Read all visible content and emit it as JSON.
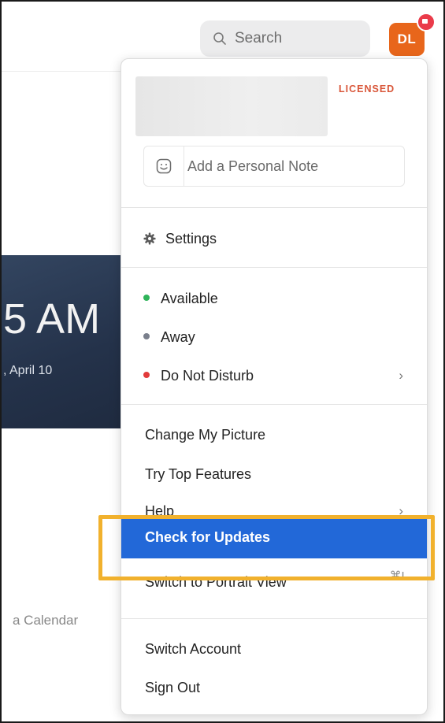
{
  "search": {
    "icon": "search-icon",
    "label": "Search"
  },
  "avatar": {
    "initials": "DL",
    "color": "#e8661b",
    "badge_color": "#ea3b4a"
  },
  "background": {
    "time": "5 AM",
    "date": ", April 10",
    "calendar_text": "a Calendar"
  },
  "menu": {
    "license_badge": "LICENSED",
    "note_placeholder": "Add a Personal Note",
    "settings": "Settings",
    "status": [
      {
        "label": "Available",
        "color": "#2fb45a"
      },
      {
        "label": "Away",
        "color": "#7a7f8c"
      },
      {
        "label": "Do Not Disturb",
        "color": "#e23b3b"
      }
    ],
    "change_picture": "Change My Picture",
    "top_features": "Try Top Features",
    "help": "Help",
    "check_updates": "Check for Updates",
    "portrait_view": "Switch to Portrait View",
    "portrait_shortcut": "⌘L",
    "switch_account": "Switch Account",
    "sign_out": "Sign Out"
  },
  "highlight_color": "#2268d8",
  "callout_color": "#f1b12d"
}
